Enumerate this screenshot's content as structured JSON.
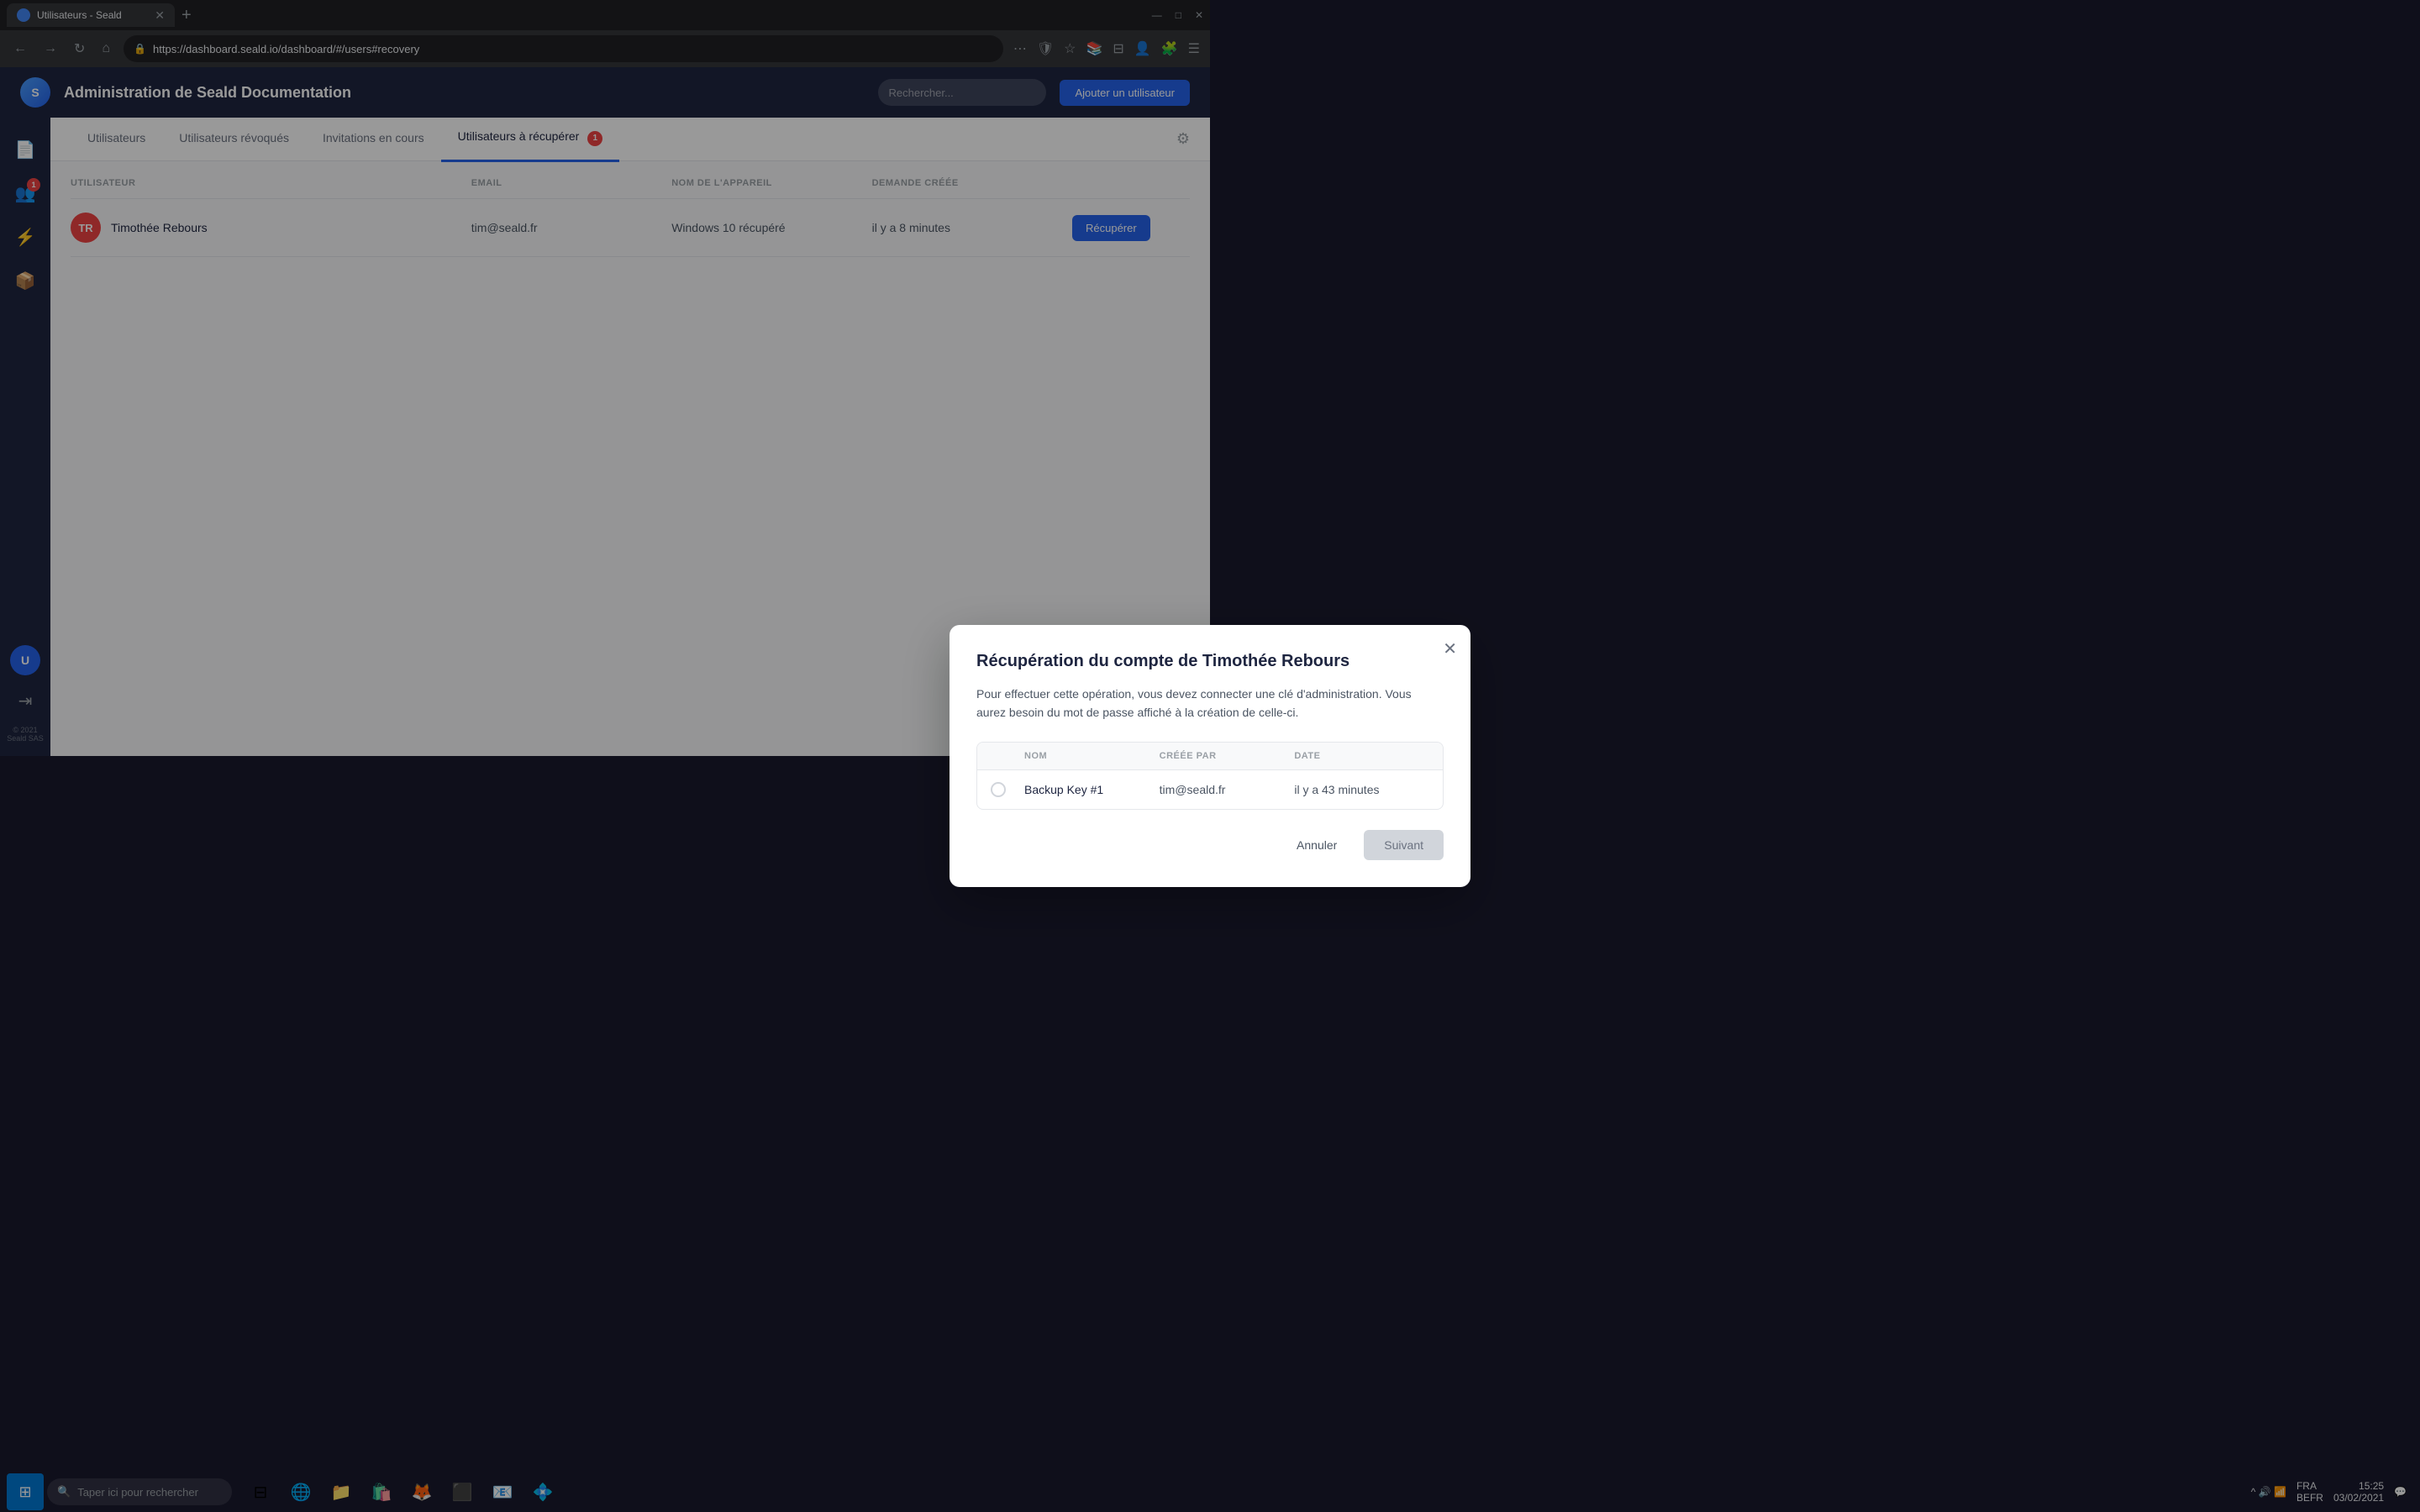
{
  "browser": {
    "tab_title": "Utilisateurs - Seald",
    "tab_new_label": "+",
    "url": "https://dashboard.seald.io/dashboard/#/users#recovery",
    "window_minimize": "—",
    "window_maximize": "□",
    "window_close": "✕"
  },
  "app": {
    "title": "Administration de Seald Documentation",
    "search_placeholder": "Rechercher...",
    "add_user_label": "Ajouter un utilisateur"
  },
  "tabs": {
    "items": [
      {
        "label": "Utilisateurs",
        "active": false,
        "badge": null
      },
      {
        "label": "Utilisateurs révoqués",
        "active": false,
        "badge": null
      },
      {
        "label": "Invitations en cours",
        "active": false,
        "badge": null
      },
      {
        "label": "Utilisateurs à récupérer",
        "active": true,
        "badge": "1"
      }
    ]
  },
  "table": {
    "headers": {
      "user": "Utilisateur",
      "email": "Email",
      "device": "Nom de l'appareil",
      "created": "Demande créée"
    },
    "rows": [
      {
        "initials": "TR",
        "name": "Timothée Rebours",
        "email": "tim@seald.fr",
        "device": "Windows 10 récupéré",
        "created": "il y a 8 minutes",
        "action": "Récupérer"
      }
    ]
  },
  "modal": {
    "title": "Récupération du compte de Timothée Rebours",
    "description": "Pour effectuer cette opération, vous devez connecter une clé d'administration. Vous aurez besoin du mot de passe affiché à la création de celle-ci.",
    "close_label": "✕",
    "keys_table": {
      "headers": {
        "select": "",
        "name": "Nom",
        "created_by": "Créée par",
        "date": "Date"
      },
      "rows": [
        {
          "name": "Backup Key #1",
          "created_by": "tim@seald.fr",
          "date": "il y a 43 minutes"
        }
      ]
    },
    "cancel_label": "Annuler",
    "next_label": "Suivant"
  },
  "sidebar": {
    "items": [
      {
        "icon": "📄",
        "name": "documents-icon"
      },
      {
        "icon": "👥",
        "name": "users-icon",
        "active": true,
        "badge": "1"
      },
      {
        "icon": "⚡",
        "name": "activity-icon"
      },
      {
        "icon": "📦",
        "name": "packages-icon"
      }
    ],
    "bottom": {
      "avatar": "U",
      "logout_icon": "→",
      "copyright": "© 2021\nSeald SAS"
    }
  },
  "taskbar": {
    "search_placeholder": "Taper ici pour rechercher",
    "apps": [
      "⊞",
      "🔍",
      "📁",
      "🛍️",
      "🦊",
      "⬛",
      "📧",
      "🌐"
    ],
    "tray": {
      "lang": "FRA\nBEFR",
      "time": "15:25",
      "date": "03/02/2021"
    }
  }
}
